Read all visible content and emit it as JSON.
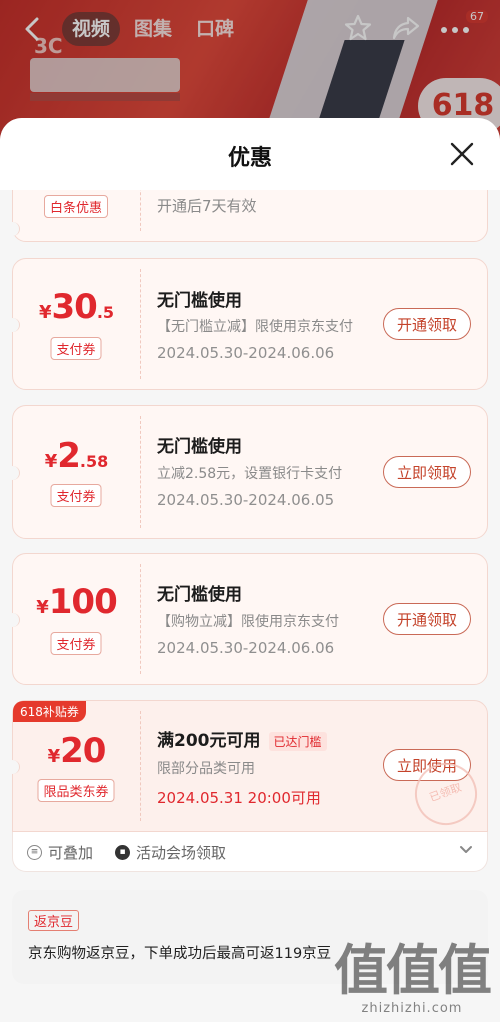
{
  "background": {
    "tabs": [
      {
        "label": "视频",
        "active": true
      },
      {
        "label": "图集",
        "active": false
      },
      {
        "label": "口碑",
        "active": false
      }
    ],
    "badge_count": "67",
    "promo_badge": "618",
    "brand_text": "3C"
  },
  "sheet": {
    "title": "优惠"
  },
  "coupons": [
    {
      "tag": "白条优惠",
      "desc": "开通后7天有效"
    },
    {
      "yen": "¥",
      "amount_int": "30",
      "amount_dec": ".5",
      "tag": "支付券",
      "title": "无门槛使用",
      "desc": "【无门槛立减】限使用京东支付",
      "date": "2024.05.30-2024.06.06",
      "button": "开通领取"
    },
    {
      "yen": "¥",
      "amount_int": "2",
      "amount_dec": ".58",
      "tag": "支付券",
      "title": "无门槛使用",
      "desc": "立减2.58元，设置银行卡支付",
      "date": "2024.05.30-2024.06.05",
      "button": "立即领取"
    },
    {
      "yen": "¥",
      "amount_int": "100",
      "amount_dec": "",
      "tag": "支付券",
      "title": "无门槛使用",
      "desc": "【购物立减】限使用京东支付",
      "date": "2024.05.30-2024.06.06",
      "button": "开通领取"
    },
    {
      "corner_tag": "618补贴券",
      "yen": "¥",
      "amount_int": "20",
      "amount_dec": "",
      "tag": "限品类东券",
      "title": "满200元可用",
      "reached": "已达门槛",
      "desc": "限部分品类可用",
      "date": "2024.05.31 20:00可用",
      "button": "立即使用",
      "stamp": "已领取"
    }
  ],
  "coupon_footer": {
    "stackable": "可叠加",
    "venue": "活动会场领取"
  },
  "jd_bean": {
    "tag": "返京豆",
    "text": "京东购物返京豆，下单成功后最高可返119京豆"
  },
  "watermark": {
    "glyphs": "值值值",
    "url": "zhizhizhi.com"
  }
}
